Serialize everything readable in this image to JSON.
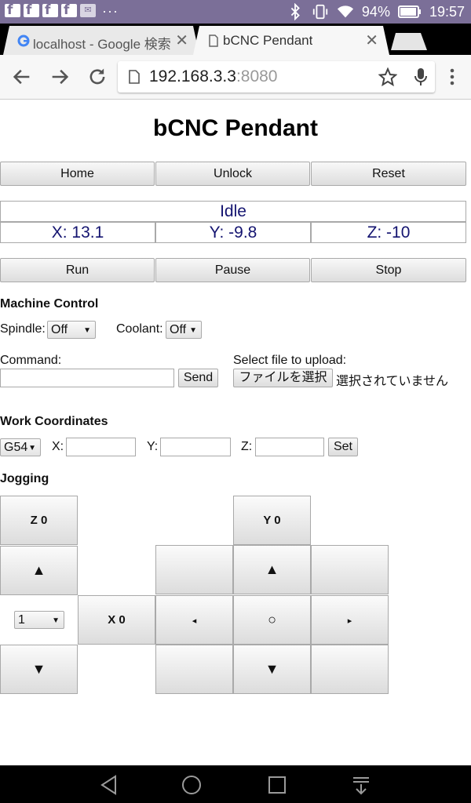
{
  "statusbar": {
    "battery": "94%",
    "time": "19:57",
    "more": "···"
  },
  "tabs": [
    {
      "title": "localhost - Google 検索",
      "close": "✕"
    },
    {
      "title": "bCNC Pendant",
      "close": "✕"
    }
  ],
  "omnibox": {
    "host": "192.168.3.3",
    "port": ":8080"
  },
  "page": {
    "title": "bCNC Pendant",
    "top_buttons": [
      "Home",
      "Unlock",
      "Reset"
    ],
    "state": "Idle",
    "coords": [
      "X: 13.1",
      "Y: -9.8",
      "Z: -10"
    ],
    "run_buttons": [
      "Run",
      "Pause",
      "Stop"
    ],
    "machine_control": {
      "heading": "Machine Control",
      "spindle_label": "Spindle:",
      "spindle_value": "Off",
      "coolant_label": "Coolant:",
      "coolant_value": "Off"
    },
    "command": {
      "label": "Command:",
      "send": "Send",
      "upload_label": "Select file to upload:",
      "file_button": "ファイルを選択",
      "file_status": "選択されていません"
    },
    "work_coords": {
      "heading": "Work Coordinates",
      "system": "G54",
      "x_label": "X:",
      "y_label": "Y:",
      "z_label": "Z:",
      "set": "Set"
    },
    "jogging": {
      "heading": "Jogging",
      "z0": "Z 0",
      "y0": "Y 0",
      "x0": "X 0",
      "step": "1",
      "up": "▲",
      "down": "▼",
      "left": "◂",
      "right": "▸",
      "center": "○"
    }
  },
  "colors": {
    "statusbar": "#7b6f98",
    "coord_text": "#141470"
  }
}
